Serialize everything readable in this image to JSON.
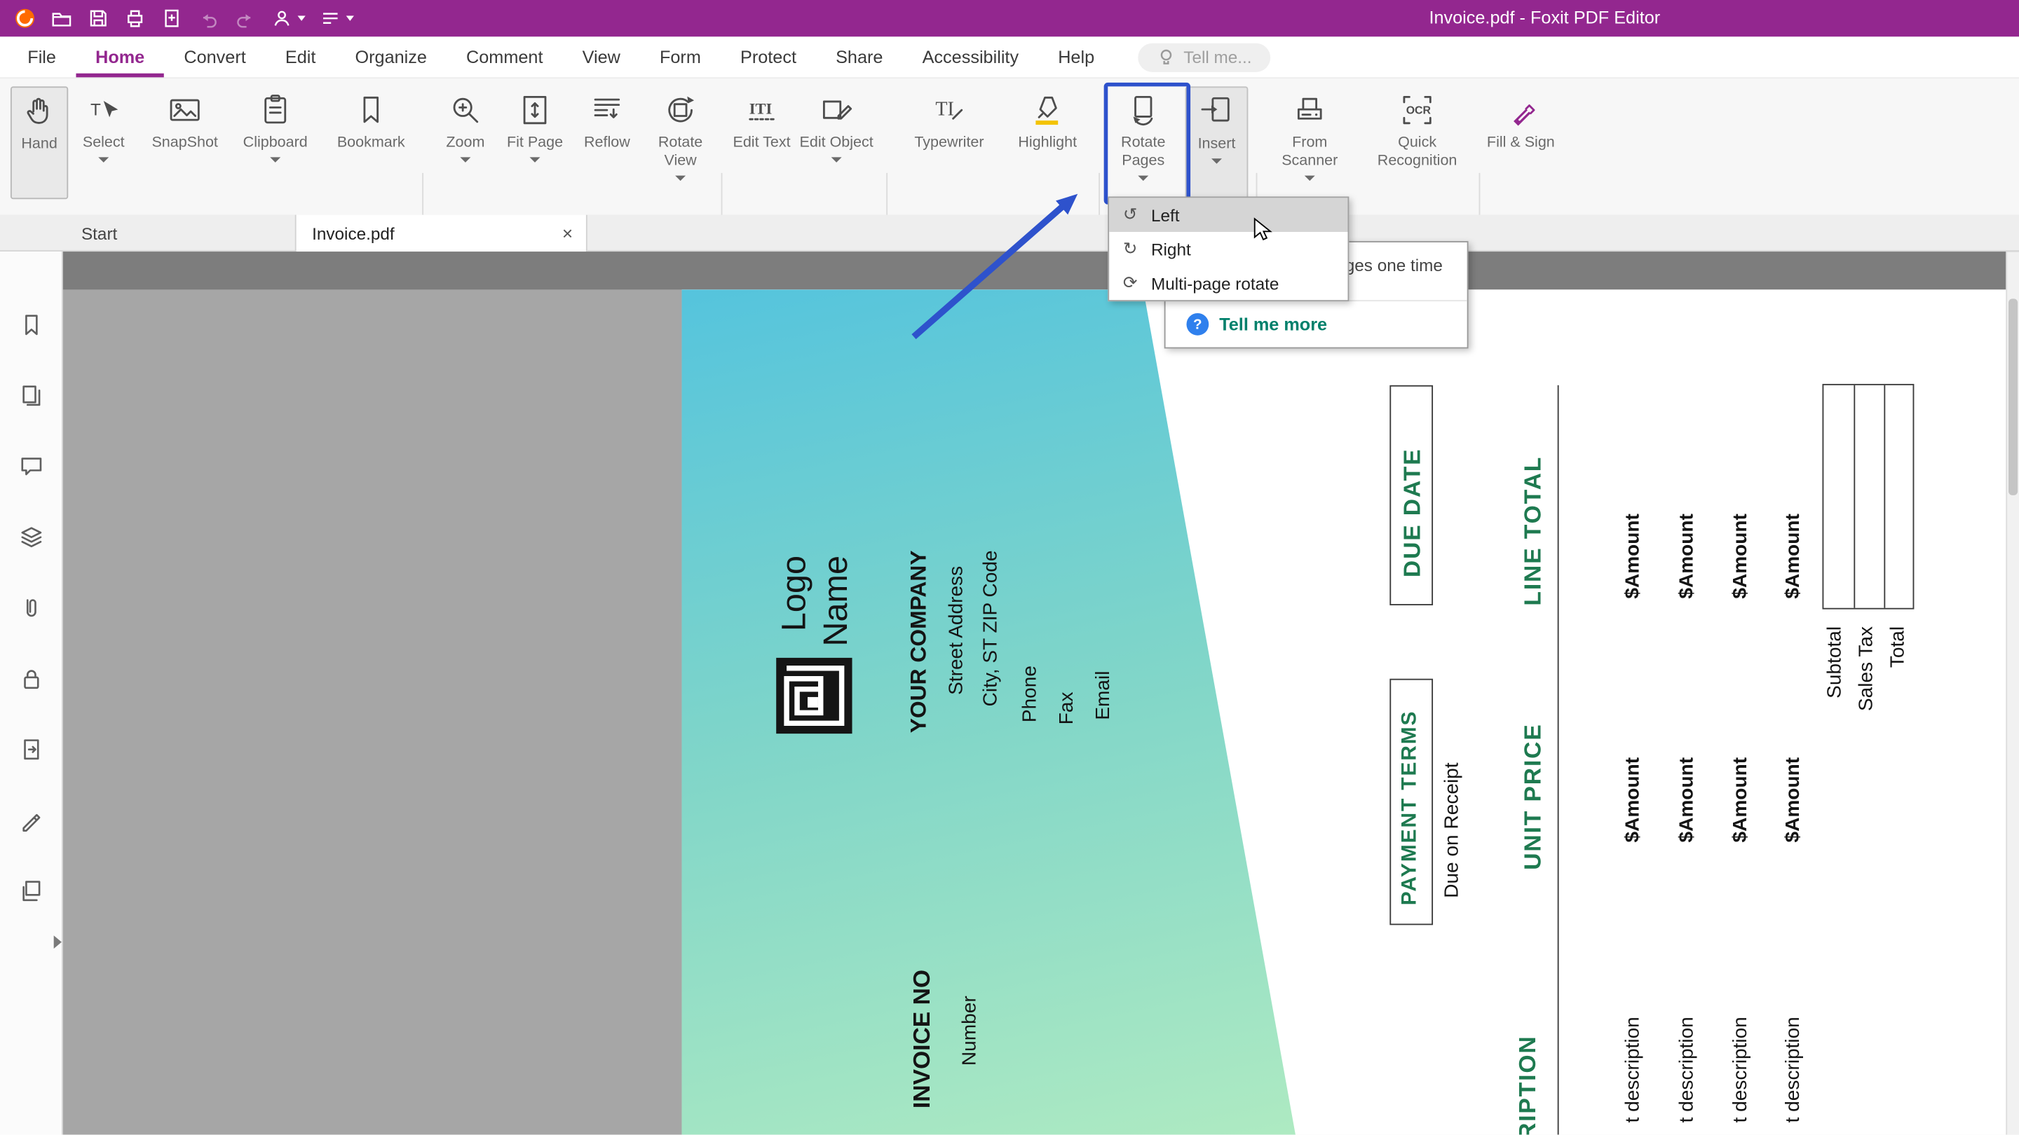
{
  "app": {
    "title": "Invoice.pdf - Foxit PDF Editor"
  },
  "menubar": {
    "items": [
      "File",
      "Home",
      "Convert",
      "Edit",
      "Organize",
      "Comment",
      "View",
      "Form",
      "Protect",
      "Share",
      "Accessibility",
      "Help"
    ],
    "active_item": "Home",
    "tellme_placeholder": "Tell me..."
  },
  "ribbon": {
    "buttons": [
      {
        "label": "Hand"
      },
      {
        "label": "Select"
      },
      {
        "label": "SnapShot"
      },
      {
        "label": "Clipboard"
      },
      {
        "label": "Bookmark"
      },
      {
        "label": "Zoom"
      },
      {
        "label": "Fit Page"
      },
      {
        "label": "Reflow"
      },
      {
        "label": "Rotate View"
      },
      {
        "label": "Edit Text"
      },
      {
        "label": "Edit Object"
      },
      {
        "label": "Typewriter"
      },
      {
        "label": "Highlight"
      },
      {
        "label": "Rotate Pages"
      },
      {
        "label": "Insert"
      },
      {
        "label": "From Scanner"
      },
      {
        "label": "Quick Recognition"
      },
      {
        "label": "Fill & Sign"
      }
    ]
  },
  "tabs": {
    "start": "Start",
    "document": "Invoice.pdf",
    "close_glyph": "×"
  },
  "rotate_menu": {
    "highlighted": "Left",
    "items": [
      {
        "label": "Left",
        "icon_glyph": "↺"
      },
      {
        "label": "Right",
        "icon_glyph": "↻"
      },
      {
        "label": "Multi-page rotate",
        "icon_glyph": "⟳"
      }
    ]
  },
  "tooltip": {
    "visible_text": "ges one time",
    "help_glyph": "?",
    "link_label": "Tell me more"
  },
  "invoice": {
    "logo_line1": "Logo",
    "logo_line2": "Name",
    "company": "YOUR COMPANY",
    "address_line1": "Street Address",
    "address_line2": "City, ST ZIP Code",
    "phone": "Phone",
    "fax": "Fax",
    "email": "Email",
    "invoice_no_label": "INVOICE NO",
    "invoice_no_value": "Number",
    "due_date_label": "DUE DATE",
    "payment_terms_label": "PAYMENT TERMS",
    "payment_terms_value": "Due on Receipt",
    "line_total_label": "LINE TOTAL",
    "unit_price_label": "UNIT PRICE",
    "amount_text": "$Amount",
    "subtotal_label": "Subtotal",
    "sales_tax_label": "Sales Tax",
    "total_label": "Total",
    "description_label_cropped": "RIPTION",
    "description_item_cropped": "t description"
  },
  "colors": {
    "titlebar": "#93278F",
    "accent_purple": "#93278F",
    "annotation_blue": "#2E52CC",
    "invoice_green": "#1E7A50",
    "page_teal_top": "#55C4DD",
    "page_teal_bottom": "#AEEAC2",
    "highlight_yellow": "#F3C300",
    "tellmore_teal": "#00806B"
  },
  "icons": {
    "titlebar": [
      "foxit-logo",
      "open-folder-icon",
      "save-icon",
      "print-icon",
      "create-pdf-icon",
      "undo-icon",
      "redo-icon",
      "share-icon",
      "customize-toolbar-icon"
    ],
    "sidebar": [
      "bookmarks-panel-icon",
      "pages-panel-icon",
      "comments-panel-icon",
      "layers-panel-icon",
      "attachments-panel-icon",
      "security-panel-icon",
      "destinations-panel-icon",
      "signature-panel-icon",
      "stamps-panel-icon"
    ]
  }
}
